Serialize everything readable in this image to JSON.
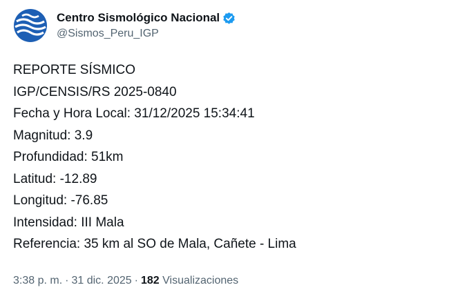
{
  "account": {
    "display_name": "Centro Sismológico Nacional",
    "handle": "@Sismos_Peru_IGP",
    "avatar_icon": "globe-waves-logo-icon",
    "verified_icon": "verified-badge-icon",
    "colors": {
      "avatar_bg": "#1d5fb4",
      "verified": "#1d9bf0",
      "handle": "#536471",
      "text": "#0f1419"
    }
  },
  "tweet": {
    "lines": [
      "REPORTE SÍSMICO",
      "IGP/CENSIS/RS 2025-0840",
      "Fecha y Hora Local: 31/12/2025 15:34:41",
      "Magnitud: 3.9",
      "Profundidad: 51km",
      "Latitud: -12.89",
      "Longitud: -76.85",
      "Intensidad: III Mala",
      "Referencia: 35 km al SO de Mala, Cañete - Lima"
    ]
  },
  "meta": {
    "time": "3:38 p. m.",
    "separator": "·",
    "date": "31 dic. 2025",
    "views_count": "182",
    "views_label": "Visualizaciones"
  }
}
